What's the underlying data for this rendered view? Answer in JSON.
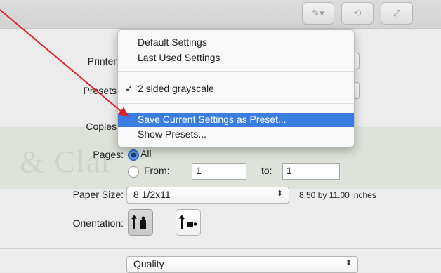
{
  "toolbar": {
    "buttons": [
      "pencil-icon",
      "plus-minus-icon",
      "refresh-icon",
      "expand-icon"
    ]
  },
  "labels": {
    "printer": "Printer",
    "presets": "Presets",
    "copies": "Copies",
    "pages": "Pages:",
    "paper_size": "Paper Size:",
    "orientation": "Orientation:"
  },
  "pages": {
    "all_label": "All",
    "from_label": "From:",
    "from_value": "1",
    "to_label": "to:",
    "to_value": "1",
    "selected": "All"
  },
  "paper_size": {
    "value": "8 1/2x11",
    "dimensions": "8.50 by 11.00 inches"
  },
  "section_popup": {
    "value": "Quality"
  },
  "presets_menu": {
    "items": [
      {
        "label": "Default Settings",
        "checked": false,
        "highlighted": false
      },
      {
        "label": "Last Used Settings",
        "checked": false,
        "highlighted": false
      },
      {
        "label": "2 sided grayscale",
        "checked": true,
        "highlighted": false
      },
      {
        "label": "Save Current Settings as Preset...",
        "checked": false,
        "highlighted": true
      },
      {
        "label": "Show Presets...",
        "checked": false,
        "highlighted": false
      }
    ],
    "checkmark": "✓"
  },
  "annotation": {
    "color": "#e0202a"
  },
  "watermark": "& Clar"
}
